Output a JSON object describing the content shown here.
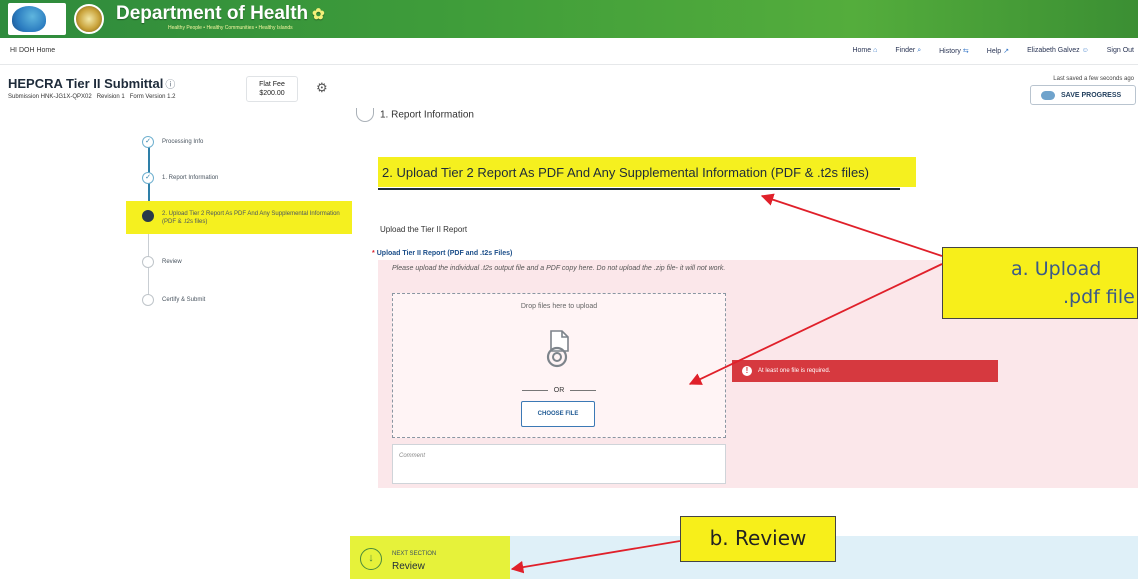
{
  "banner": {
    "title": "Department of Health",
    "tagline": "Healthy People • Healthy Communities • Healthy Islands"
  },
  "topnav": {
    "home": "HI DOH Home",
    "links": [
      {
        "label": "Home",
        "icon": "home-icon"
      },
      {
        "label": "Finder",
        "icon": "search-icon"
      },
      {
        "label": "History",
        "icon": "history-icon"
      },
      {
        "label": "Help",
        "icon": "external-link-icon"
      },
      {
        "label": "Elizabeth Galvez",
        "icon": "user-icon"
      },
      {
        "label": "Sign Out",
        "icon": ""
      }
    ]
  },
  "header": {
    "form_title": "HEPCRA Tier II Submittal",
    "submission": "Submission HNK-JG1X-QPX02",
    "revision": "Revision 1",
    "form_version": "Form Version 1.2",
    "fee_label": "Flat Fee",
    "fee_value": "$200.00",
    "last_saved": "Last saved a few seconds ago",
    "save_button": "SAVE PROGRESS"
  },
  "steps": [
    {
      "label": "Processing Info",
      "state": "done"
    },
    {
      "label": "1. Report Information",
      "state": "done"
    },
    {
      "label": "2. Upload Tier 2 Report As PDF And Any Supplemental Information (PDF & .t2s files)",
      "state": "active"
    },
    {
      "label": "Review",
      "state": "pending"
    },
    {
      "label": "Certify & Submit",
      "state": "pending"
    }
  ],
  "main": {
    "prev_section": "1. Report Information",
    "section_title": "2. Upload Tier 2 Report As PDF And Any Supplemental Information (PDF & .t2s files)",
    "upload_title": "Upload the Tier II Report",
    "field_label": "Upload Tier II Report (PDF and .t2s Files)",
    "instructions": "Please upload the individual .t2s output file and a PDF copy here. Do not upload the .zip file- it will not work.",
    "drop_text": "Drop files here to upload",
    "or_text": "OR",
    "choose_button": "CHOOSE FILE",
    "comment_placeholder": "Comment",
    "error_text": "At least one file is required."
  },
  "next_section": {
    "label": "NEXT SECTION",
    "value": "Review"
  },
  "callouts": {
    "a_line1": "a.   Upload",
    "a_line2": ".pdf file",
    "b": "b. Review"
  },
  "colors": {
    "banner_green": "#3f9d3a",
    "highlight_yellow": "#f5f01f",
    "error_red": "#d6393f",
    "arrow_red": "#e0202a",
    "link_blue": "#1c4f8a"
  }
}
